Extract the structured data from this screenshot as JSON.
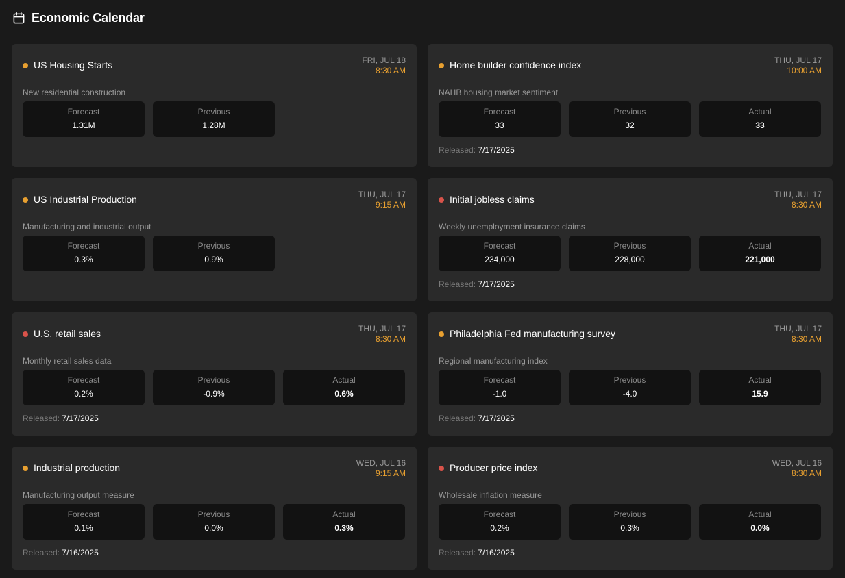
{
  "header": {
    "title": "Economic Calendar",
    "icon": "calendar-icon"
  },
  "colors": {
    "orange": "#e8a030",
    "red": "#d9534a"
  },
  "labels": {
    "forecast": "Forecast",
    "previous": "Previous",
    "actual": "Actual",
    "released": "Released:"
  },
  "events": [
    {
      "title": "US Housing Starts",
      "impact": "orange",
      "date": "FRI, JUL 18",
      "time": "8:30 AM",
      "description": "New residential construction",
      "forecast": "1.31M",
      "previous": "1.28M",
      "actual": null,
      "released": null
    },
    {
      "title": "Home builder confidence index",
      "impact": "orange",
      "date": "THU, JUL 17",
      "time": "10:00 AM",
      "description": "NAHB housing market sentiment",
      "forecast": "33",
      "previous": "32",
      "actual": "33",
      "released": "7/17/2025"
    },
    {
      "title": "US Industrial Production",
      "impact": "orange",
      "date": "THU, JUL 17",
      "time": "9:15 AM",
      "description": "Manufacturing and industrial output",
      "forecast": "0.3%",
      "previous": "0.9%",
      "actual": null,
      "released": null
    },
    {
      "title": "Initial jobless claims",
      "impact": "red",
      "date": "THU, JUL 17",
      "time": "8:30 AM",
      "description": "Weekly unemployment insurance claims",
      "forecast": "234,000",
      "previous": "228,000",
      "actual": "221,000",
      "released": "7/17/2025"
    },
    {
      "title": "U.S. retail sales",
      "impact": "red",
      "date": "THU, JUL 17",
      "time": "8:30 AM",
      "description": "Monthly retail sales data",
      "forecast": "0.2%",
      "previous": "-0.9%",
      "actual": "0.6%",
      "released": "7/17/2025"
    },
    {
      "title": "Philadelphia Fed manufacturing survey",
      "impact": "orange",
      "date": "THU, JUL 17",
      "time": "8:30 AM",
      "description": "Regional manufacturing index",
      "forecast": "-1.0",
      "previous": "-4.0",
      "actual": "15.9",
      "released": "7/17/2025"
    },
    {
      "title": "Industrial production",
      "impact": "orange",
      "date": "WED, JUL 16",
      "time": "9:15 AM",
      "description": "Manufacturing output measure",
      "forecast": "0.1%",
      "previous": "0.0%",
      "actual": "0.3%",
      "released": "7/16/2025"
    },
    {
      "title": "Producer price index",
      "impact": "red",
      "date": "WED, JUL 16",
      "time": "8:30 AM",
      "description": "Wholesale inflation measure",
      "forecast": "0.2%",
      "previous": "0.3%",
      "actual": "0.0%",
      "released": "7/16/2025"
    }
  ]
}
